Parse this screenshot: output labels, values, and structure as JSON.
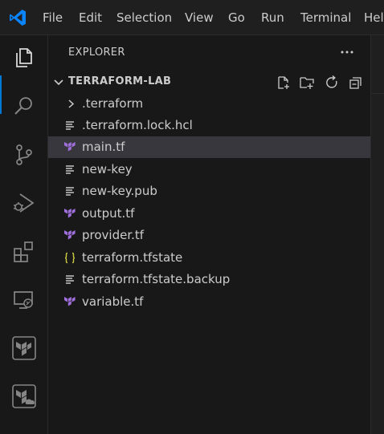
{
  "menu": {
    "items": [
      "File",
      "Edit",
      "Selection",
      "View",
      "Go",
      "Run",
      "Terminal",
      "Hel"
    ]
  },
  "activity_bar": {
    "icons": [
      "explorer-icon",
      "search-icon",
      "source-control-icon",
      "run-debug-icon",
      "extensions-icon",
      "remote-explorer-icon",
      "terraform-icon",
      "terraform-cloud-icon"
    ],
    "active": "explorer-icon"
  },
  "sidebar": {
    "title": "EXPLORER",
    "folder": "TERRAFORM-LAB",
    "header_actions": [
      "new-file-icon",
      "new-folder-icon",
      "refresh-icon",
      "collapse-all-icon"
    ],
    "files": [
      {
        "label": ".terraform",
        "type": "folder",
        "icon": "chevron-right-icon"
      },
      {
        "label": ".terraform.lock.hcl",
        "type": "file",
        "icon": "lines-file-icon"
      },
      {
        "label": "main.tf",
        "type": "file",
        "icon": "terraform-file-icon",
        "selected": true
      },
      {
        "label": "new-key",
        "type": "file",
        "icon": "lines-file-icon"
      },
      {
        "label": "new-key.pub",
        "type": "file",
        "icon": "lines-file-icon"
      },
      {
        "label": "output.tf",
        "type": "file",
        "icon": "terraform-file-icon"
      },
      {
        "label": "provider.tf",
        "type": "file",
        "icon": "terraform-file-icon"
      },
      {
        "label": "terraform.tfstate",
        "type": "file",
        "icon": "json-braces-icon"
      },
      {
        "label": "terraform.tfstate.backup",
        "type": "file",
        "icon": "lines-file-icon"
      },
      {
        "label": "variable.tf",
        "type": "file",
        "icon": "terraform-file-icon"
      }
    ]
  },
  "colors": {
    "accent": "#0078d4",
    "terraform": "#7b42bc",
    "json_braces": "#cbcb41",
    "selection": "#37373d"
  }
}
